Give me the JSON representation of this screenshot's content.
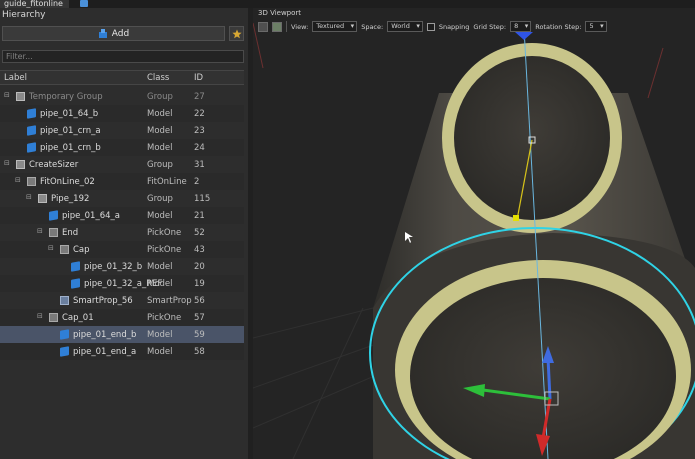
{
  "window": {
    "tab_title": "guide_fitonline"
  },
  "hierarchy": {
    "title": "Hierarchy",
    "add_label": "Add",
    "filter_placeholder": "Filter...",
    "columns": {
      "label": "Label",
      "class": "Class",
      "id": "ID"
    },
    "rows": [
      {
        "label": "Temporary Group",
        "class": "Group",
        "id": "27",
        "icon": "group-icon"
      },
      {
        "label": "pipe_01_64_b",
        "class": "Model",
        "id": "22",
        "icon": "model-icon"
      },
      {
        "label": "pipe_01_crn_a",
        "class": "Model",
        "id": "23",
        "icon": "model-icon"
      },
      {
        "label": "pipe_01_crn_b",
        "class": "Model",
        "id": "24",
        "icon": "model-icon"
      },
      {
        "label": "CreateSizer",
        "class": "Group",
        "id": "31",
        "icon": "group-icon"
      },
      {
        "label": "FitOnLine_02",
        "class": "FitOnLine",
        "id": "2",
        "icon": "pick-icon"
      },
      {
        "label": "Pipe_192",
        "class": "Group",
        "id": "115",
        "icon": "group-icon"
      },
      {
        "label": "pipe_01_64_a",
        "class": "Model",
        "id": "21",
        "icon": "model-icon"
      },
      {
        "label": "End",
        "class": "PickOne",
        "id": "52",
        "icon": "pick-icon"
      },
      {
        "label": "Cap",
        "class": "PickOne",
        "id": "43",
        "icon": "pick-icon"
      },
      {
        "label": "pipe_01_32_b",
        "class": "Model",
        "id": "20",
        "icon": "model-icon"
      },
      {
        "label": "pipe_01_32_a_REF",
        "class": "Model",
        "id": "19",
        "icon": "model-icon"
      },
      {
        "label": "SmartProp_56",
        "class": "SmartProp",
        "id": "56",
        "icon": "smartprop-icon"
      },
      {
        "label": "Cap_01",
        "class": "PickOne",
        "id": "57",
        "icon": "pick-icon"
      },
      {
        "label": "pipe_01_end_b",
        "class": "Model",
        "id": "59",
        "icon": "model-icon",
        "selected": true
      },
      {
        "label": "pipe_01_end_a",
        "class": "Model",
        "id": "58",
        "icon": "model-icon"
      }
    ]
  },
  "viewport": {
    "title": "3D Viewport",
    "view_label": "View:",
    "view_value": "Textured",
    "space_label": "Space:",
    "space_value": "World",
    "snapping_label": "Snapping",
    "grid_step_label": "Grid Step:",
    "grid_step_value": "8",
    "rotation_step_label": "Rotation Step:",
    "rotation_step_value": "5"
  },
  "colors": {
    "selection": "#4a5468",
    "ring": "#c8c58a",
    "ring_outline": "#2fd3e6",
    "gizmo_x": "#2dbf3a",
    "gizmo_y": "#3f6be0",
    "gizmo_z": "#d02a2a",
    "pipe": "#4a4741"
  }
}
